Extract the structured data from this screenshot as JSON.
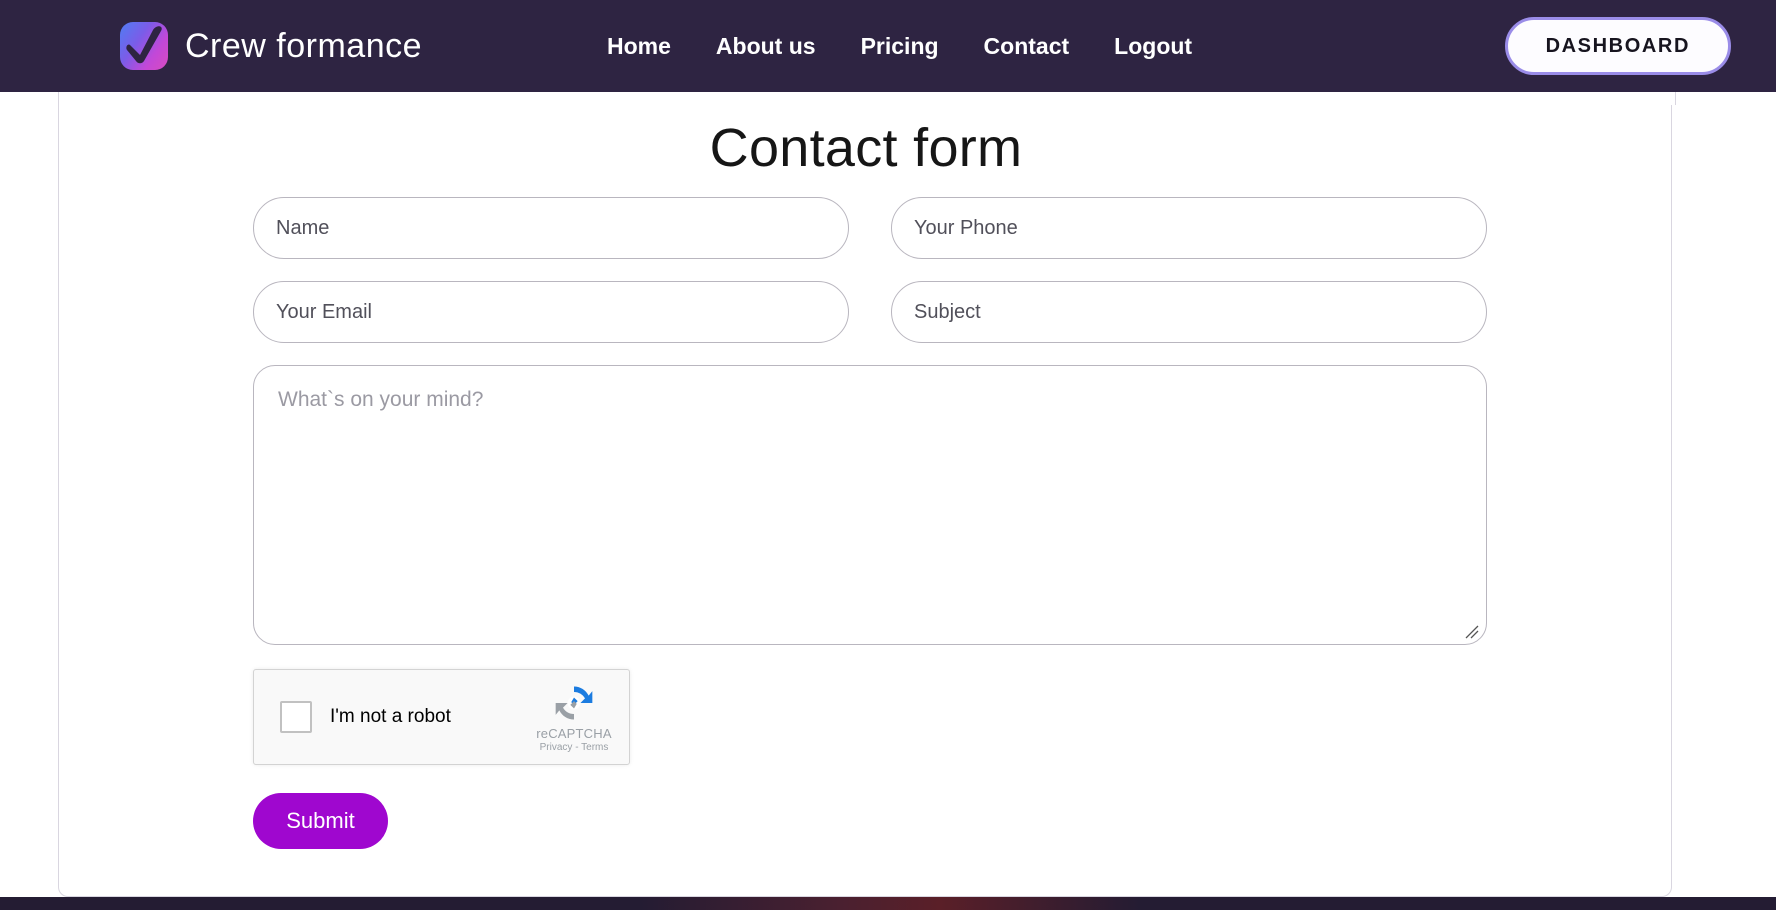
{
  "header": {
    "brand_name": "Crew formance",
    "logo_icon": "checkmark-logo-icon",
    "nav": [
      {
        "label": "Home"
      },
      {
        "label": "About us"
      },
      {
        "label": "Pricing"
      },
      {
        "label": "Contact"
      },
      {
        "label": "Logout"
      }
    ],
    "dashboard_button": "DASHBOARD",
    "background_color": "#2e2442",
    "dashboard_border_color": "#9a8ce8"
  },
  "main": {
    "title": "Contact form",
    "form": {
      "name": {
        "placeholder": "Name",
        "value": ""
      },
      "phone": {
        "placeholder": "Your Phone",
        "value": ""
      },
      "email": {
        "placeholder": "Your Email",
        "value": ""
      },
      "subject": {
        "placeholder": "Subject",
        "value": ""
      },
      "message": {
        "placeholder": "What`s on your mind?",
        "value": ""
      },
      "submit_label": "Submit",
      "submit_color": "#9f07cf"
    },
    "recaptcha": {
      "checkbox_label": "I'm not a robot",
      "brand_name": "reCAPTCHA",
      "privacy_label": "Privacy",
      "separator": "-",
      "terms_label": "Terms",
      "logo_icon": "recaptcha-logo-icon",
      "checked": false
    }
  }
}
